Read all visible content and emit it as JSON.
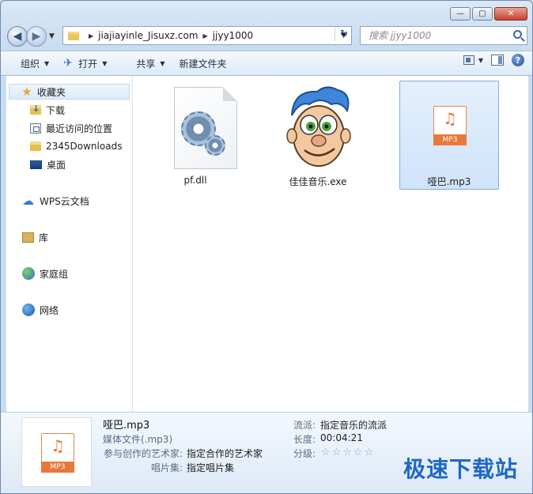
{
  "window": {
    "caption_buttons": {
      "minimize": "—",
      "maximize": "▢",
      "close": "✕"
    }
  },
  "address": {
    "segments": [
      "jiajiayinle_Jisuxz.com",
      "jjyy1000"
    ],
    "refresh_glyph": "↻"
  },
  "search": {
    "placeholder": "搜索 jjyy1000"
  },
  "toolbar": {
    "organize": "组织",
    "open": "打开",
    "share": "共享",
    "new_folder": "新建文件夹"
  },
  "sidebar": {
    "favorites_label": "收藏夹",
    "favorites": [
      "下载",
      "最近访问的位置",
      "2345Downloads",
      "桌面"
    ],
    "wps": "WPS云文档",
    "libraries": "库",
    "homegroup": "家庭组",
    "network": "网络"
  },
  "files": [
    {
      "name": "pf.dll",
      "icon": "dll-gear-icon",
      "selected": false
    },
    {
      "name": "佳佳音乐.exe",
      "icon": "cartoon-face-icon",
      "selected": false
    },
    {
      "name": "哑巴.mp3",
      "icon": "mp3-file-icon",
      "selected": true
    }
  ],
  "mp3_icon": {
    "note": "♫",
    "label": "MP3"
  },
  "details": {
    "title": "哑巴.mp3",
    "type": "媒体文件(.mp3)",
    "artist_label": "参与创作的艺术家:",
    "artist_value": "指定合作的艺术家",
    "album_label": "唱片集:",
    "album_value": "指定唱片集",
    "genre_label": "流派:",
    "genre_value": "指定音乐的流派",
    "length_label": "长度:",
    "length_value": "00:04:21",
    "rating_label": "分级:",
    "rating_stars": 0
  },
  "watermark": "极速下载站",
  "colors": {
    "accent": "#1f67c8",
    "selection": "#cfe3fa",
    "mp3_orange": "#e9793a"
  }
}
